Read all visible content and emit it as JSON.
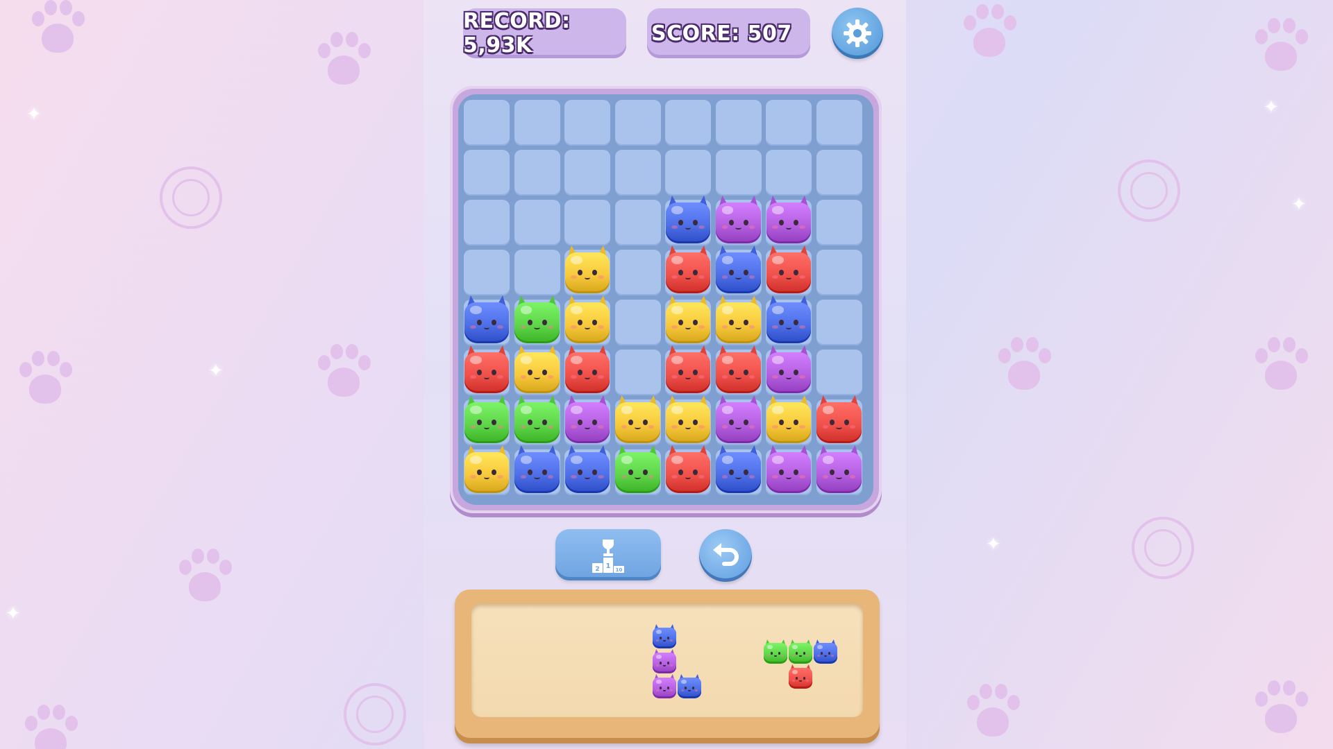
{
  "hud": {
    "record_label": "RECORD: 5,93K",
    "score_label": "SCORE: 507"
  },
  "colors": {
    "blue": "#4f6fe8",
    "purple": "#b560e0",
    "red": "#f0514a",
    "yellow": "#f8c93c",
    "green": "#5fd64a"
  },
  "board": {
    "columns": 8,
    "rows": 8,
    "cells": [
      [
        "",
        "",
        "",
        "",
        "",
        "",
        "",
        ""
      ],
      [
        "",
        "",
        "",
        "",
        "",
        "",
        "",
        ""
      ],
      [
        "",
        "",
        "",
        "",
        "blue",
        "purple",
        "purple",
        ""
      ],
      [
        "",
        "",
        "yellow",
        "",
        "red",
        "blue",
        "red",
        ""
      ],
      [
        "blue",
        "green",
        "yellow",
        "",
        "yellow",
        "yellow",
        "blue",
        ""
      ],
      [
        "red",
        "yellow",
        "red",
        "",
        "red",
        "red",
        "purple",
        ""
      ],
      [
        "green",
        "green",
        "purple",
        "yellow",
        "yellow",
        "purple",
        "yellow",
        "red"
      ],
      [
        "yellow",
        "blue",
        "blue",
        "green",
        "red",
        "blue",
        "purple",
        "purple"
      ]
    ]
  },
  "controls": {
    "leaderboard_icon": "trophy-podium-icon",
    "undo_icon": "undo-arrow-icon",
    "settings_icon": "gear-icon",
    "podium_places": [
      "2",
      "1",
      "10"
    ]
  },
  "tray": {
    "pieces": [
      {
        "name": "piece-l-shape",
        "cells": [
          {
            "row": 0,
            "col": 0,
            "color": "blue"
          },
          {
            "row": 1,
            "col": 0,
            "color": "purple"
          },
          {
            "row": 2,
            "col": 0,
            "color": "purple"
          },
          {
            "row": 2,
            "col": 1,
            "color": "blue"
          }
        ]
      },
      {
        "name": "piece-t-shape",
        "cells": [
          {
            "row": 0,
            "col": 0,
            "color": "green"
          },
          {
            "row": 0,
            "col": 1,
            "color": "green"
          },
          {
            "row": 0,
            "col": 2,
            "color": "blue"
          },
          {
            "row": 1,
            "col": 1,
            "color": "red"
          }
        ]
      }
    ]
  }
}
